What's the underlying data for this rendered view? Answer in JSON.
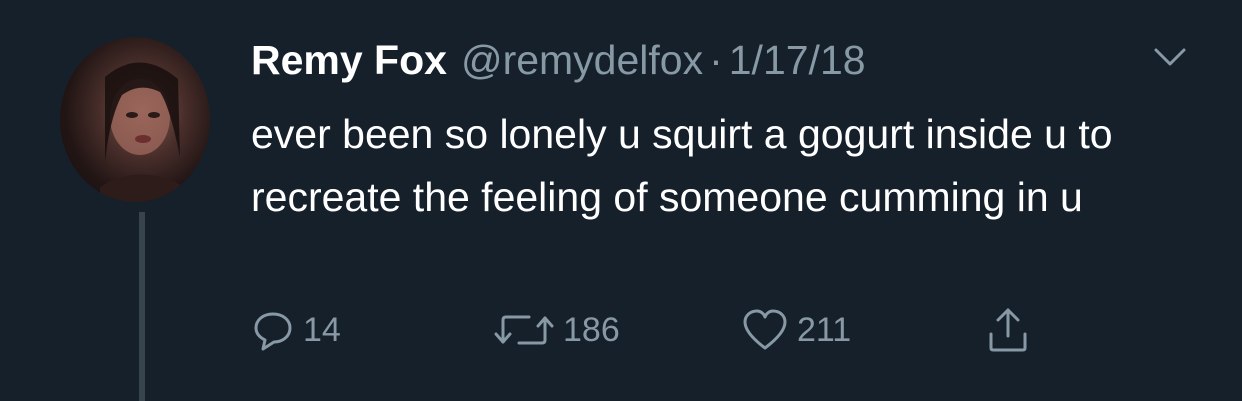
{
  "tweet": {
    "display_name": "Remy Fox",
    "handle": "@remydelfox",
    "separator": "·",
    "date": "1/17/18",
    "text": "ever been so lonely u squirt a gogurt inside u to recreate the feeling of someone cumming in u"
  },
  "actions": {
    "reply": {
      "icon": "reply-icon",
      "count": "14"
    },
    "retweet": {
      "icon": "retweet-icon",
      "count": "186"
    },
    "like": {
      "icon": "heart-icon",
      "count": "211"
    },
    "share": {
      "icon": "share-icon"
    }
  },
  "colors": {
    "background": "#15202b",
    "primary_text": "#ffffff",
    "secondary_text": "#8899a6",
    "thread_line": "#38444d"
  }
}
